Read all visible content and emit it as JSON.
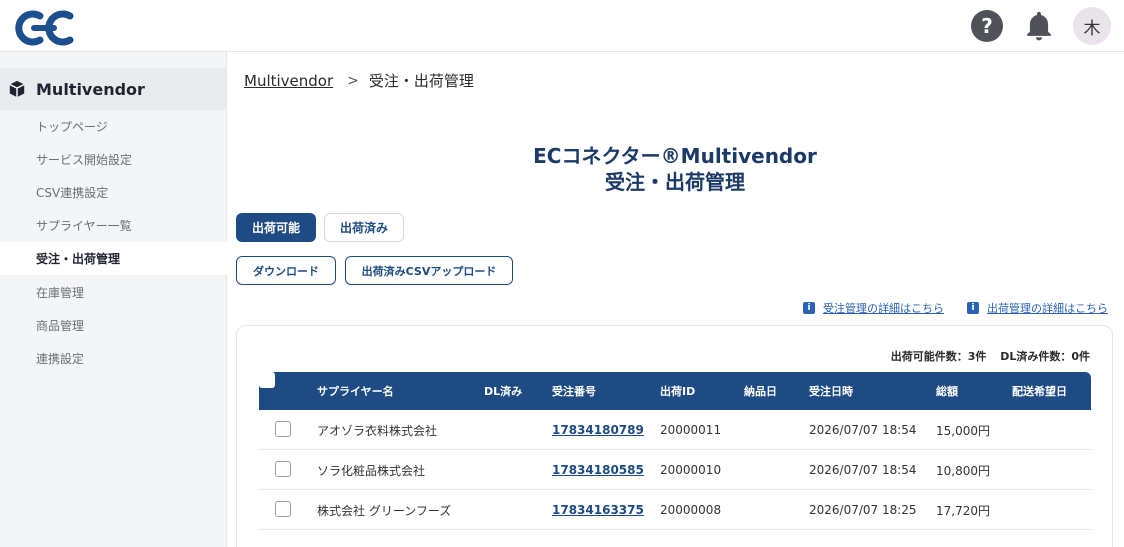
{
  "header": {
    "avatar_initial": "木",
    "help_glyph": "?",
    "icons": [
      "logo",
      "help-icon",
      "bell-icon",
      "avatar"
    ]
  },
  "sidebar": {
    "title": "Multivendor",
    "items": [
      {
        "label": "トップページ",
        "active": false
      },
      {
        "label": "サービス開始設定",
        "active": false
      },
      {
        "label": "CSV連携設定",
        "active": false
      },
      {
        "label": "サプライヤー一覧",
        "active": false
      },
      {
        "label": "受注・出荷管理",
        "active": true
      },
      {
        "label": "在庫管理",
        "active": false
      },
      {
        "label": "商品管理",
        "active": false
      },
      {
        "label": "連携設定",
        "active": false
      }
    ]
  },
  "breadcrumb": {
    "root": "Multivendor",
    "separator": ">",
    "current": "受注・出荷管理"
  },
  "title": {
    "line1": "ECコネクター®Multivendor",
    "line2": "受注・出荷管理"
  },
  "tabs": [
    {
      "label": "出荷可能",
      "active": true
    },
    {
      "label": "出荷済み",
      "active": false
    }
  ],
  "actions": {
    "download": "ダウンロード",
    "upload": "出荷済みCSVアップロード"
  },
  "help_links": {
    "order": "受注管理の詳細はこちら",
    "shipping": "出荷管理の詳細はこちら"
  },
  "counts": {
    "shippable": "出荷可能件数：3件",
    "downloaded": "DL済み件数：0件"
  },
  "table": {
    "columns": {
      "supplier": "サプライヤー名",
      "dl": "DL済み",
      "order_no": "受注番号",
      "shipment_id": "出荷ID",
      "delivery_date": "納品日",
      "order_datetime": "受注日時",
      "total": "総額",
      "requested_date": "配送希望日"
    },
    "rows": [
      {
        "supplier": "アオゾラ衣料株式会社",
        "dl": "",
        "order_no": "17834180789",
        "shipment_id": "20000011",
        "delivery_date": "",
        "order_datetime": "2026/07/07 18:54",
        "total": "15,000円",
        "requested_date": ""
      },
      {
        "supplier": "ソラ化粧品株式会社",
        "dl": "",
        "order_no": "17834180585",
        "shipment_id": "20000010",
        "delivery_date": "",
        "order_datetime": "2026/07/07 18:54",
        "total": "10,800円",
        "requested_date": ""
      },
      {
        "supplier": "株式会社 グリーンフーズ",
        "dl": "",
        "order_no": "17834163375",
        "shipment_id": "20000008",
        "delivery_date": "",
        "order_datetime": "2026/07/07 18:25",
        "total": "17,720円",
        "requested_date": ""
      }
    ]
  },
  "colors": {
    "primary": "#1e4b83",
    "link": "#2a62b5",
    "sidebar_bg": "#f4f5f7",
    "logo": "#1d4f8f"
  }
}
